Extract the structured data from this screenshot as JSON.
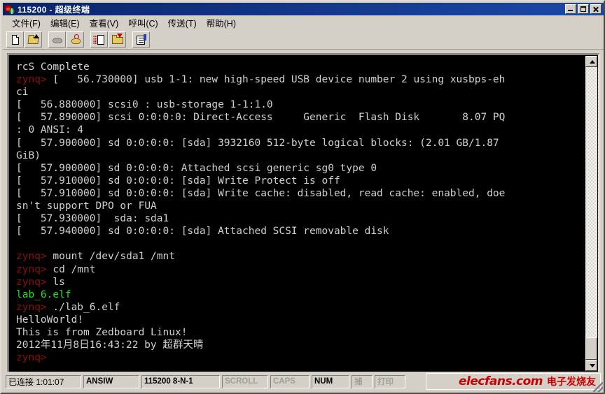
{
  "window": {
    "title": "115200 - 超级终端",
    "icon": "modem-phone-icon",
    "buttons": {
      "minimize": "minimize-icon",
      "maximize": "maximize-icon",
      "close": "close-icon"
    }
  },
  "menu": {
    "items": [
      {
        "label": "文件(F)"
      },
      {
        "label": "编辑(E)"
      },
      {
        "label": "查看(V)"
      },
      {
        "label": "呼叫(C)"
      },
      {
        "label": "传送(T)"
      },
      {
        "label": "帮助(H)"
      }
    ]
  },
  "toolbar": {
    "buttons": [
      {
        "name": "new-connection-button",
        "icon": "new-page-icon"
      },
      {
        "name": "open-connection-button",
        "icon": "open-folder-icon"
      },
      {
        "name": "disconnect-button",
        "icon": "phone-hangup-icon"
      },
      {
        "name": "call-button",
        "icon": "phone-call-icon"
      },
      {
        "name": "send-file-button",
        "icon": "send-page-icon"
      },
      {
        "name": "receive-file-button",
        "icon": "receive-folder-icon"
      },
      {
        "name": "properties-button",
        "icon": "properties-icon"
      }
    ]
  },
  "terminal": {
    "background": "#000000",
    "foreground": "#c8c8c8",
    "prompt_color": "#8b1010",
    "highlight_color": "#22dd22",
    "lines": [
      {
        "segments": [
          {
            "text": "rcS Complete",
            "color": "fg"
          }
        ]
      },
      {
        "segments": [
          {
            "text": "zynq>",
            "color": "prompt"
          },
          {
            "text": " [   56.730000] usb 1-1: new high-speed USB device number 2 using xusbps-eh",
            "color": "fg"
          }
        ]
      },
      {
        "segments": [
          {
            "text": "ci",
            "color": "fg"
          }
        ]
      },
      {
        "segments": [
          {
            "text": "[   56.880000] scsi0 : usb-storage 1-1:1.0",
            "color": "fg"
          }
        ]
      },
      {
        "segments": [
          {
            "text": "[   57.890000] scsi 0:0:0:0: Direct-Access     Generic  Flash Disk       8.07 PQ",
            "color": "fg"
          }
        ]
      },
      {
        "segments": [
          {
            "text": ": 0 ANSI: 4",
            "color": "fg"
          }
        ]
      },
      {
        "segments": [
          {
            "text": "[   57.900000] sd 0:0:0:0: [sda] 3932160 512-byte logical blocks: (2.01 GB/1.87",
            "color": "fg"
          }
        ]
      },
      {
        "segments": [
          {
            "text": "GiB)",
            "color": "fg"
          }
        ]
      },
      {
        "segments": [
          {
            "text": "[   57.900000] sd 0:0:0:0: Attached scsi generic sg0 type 0",
            "color": "fg"
          }
        ]
      },
      {
        "segments": [
          {
            "text": "[   57.910000] sd 0:0:0:0: [sda] Write Protect is off",
            "color": "fg"
          }
        ]
      },
      {
        "segments": [
          {
            "text": "[   57.910000] sd 0:0:0:0: [sda] Write cache: disabled, read cache: enabled, doe",
            "color": "fg"
          }
        ]
      },
      {
        "segments": [
          {
            "text": "sn't support DPO or FUA",
            "color": "fg"
          }
        ]
      },
      {
        "segments": [
          {
            "text": "[   57.930000]  sda: sda1",
            "color": "fg"
          }
        ]
      },
      {
        "segments": [
          {
            "text": "[   57.940000] sd 0:0:0:0: [sda] Attached SCSI removable disk",
            "color": "fg"
          }
        ]
      },
      {
        "segments": [
          {
            "text": "",
            "color": "fg"
          }
        ]
      },
      {
        "segments": [
          {
            "text": "zynq>",
            "color": "prompt"
          },
          {
            "text": " mount /dev/sda1 /mnt",
            "color": "fg"
          }
        ]
      },
      {
        "segments": [
          {
            "text": "zynq>",
            "color": "prompt"
          },
          {
            "text": " cd /mnt",
            "color": "fg"
          }
        ]
      },
      {
        "segments": [
          {
            "text": "zynq>",
            "color": "prompt"
          },
          {
            "text": " ls",
            "color": "fg"
          }
        ]
      },
      {
        "segments": [
          {
            "text": "lab_6.elf",
            "color": "green"
          }
        ]
      },
      {
        "segments": [
          {
            "text": "zynq>",
            "color": "prompt"
          },
          {
            "text": " ./lab_6.elf",
            "color": "fg"
          }
        ]
      },
      {
        "segments": [
          {
            "text": "HelloWorld!",
            "color": "fg"
          }
        ]
      },
      {
        "segments": [
          {
            "text": "This is from Zedboard Linux!",
            "color": "fg"
          }
        ]
      },
      {
        "segments": [
          {
            "text": "2012年11月8日16:43:22 by 超群天晴",
            "color": "fg"
          }
        ]
      },
      {
        "segments": [
          {
            "text": "zynq>",
            "color": "prompt"
          }
        ]
      }
    ]
  },
  "scrollbar": {
    "up_arrow": "scroll-up-icon",
    "down_arrow": "scroll-down-icon",
    "thumb_position": "bottom"
  },
  "statusbar": {
    "connected": "已连接 1:01:07",
    "emulation": "ANSIW",
    "settings": "115200 8-N-1",
    "scroll": "SCROLL",
    "caps": "CAPS",
    "num": "NUM",
    "capture": "捕",
    "print": "打印"
  },
  "watermark": {
    "brand": "elecfans.com",
    "subtitle": "电子发烧友",
    "color": "#cc0000"
  }
}
